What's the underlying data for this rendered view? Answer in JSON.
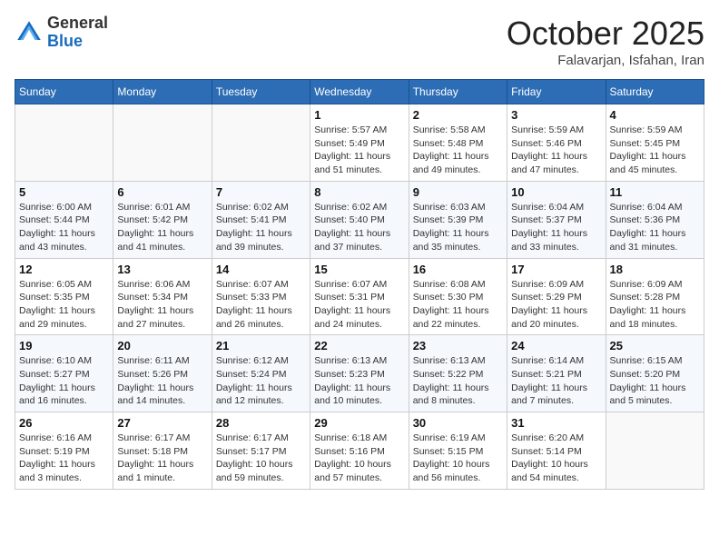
{
  "header": {
    "logo_general": "General",
    "logo_blue": "Blue",
    "month_title": "October 2025",
    "subtitle": "Falavarjan, Isfahan, Iran"
  },
  "weekdays": [
    "Sunday",
    "Monday",
    "Tuesday",
    "Wednesday",
    "Thursday",
    "Friday",
    "Saturday"
  ],
  "weeks": [
    [
      {
        "day": "",
        "sunrise": "",
        "sunset": "",
        "daylight": ""
      },
      {
        "day": "",
        "sunrise": "",
        "sunset": "",
        "daylight": ""
      },
      {
        "day": "",
        "sunrise": "",
        "sunset": "",
        "daylight": ""
      },
      {
        "day": "1",
        "sunrise": "Sunrise: 5:57 AM",
        "sunset": "Sunset: 5:49 PM",
        "daylight": "Daylight: 11 hours and 51 minutes."
      },
      {
        "day": "2",
        "sunrise": "Sunrise: 5:58 AM",
        "sunset": "Sunset: 5:48 PM",
        "daylight": "Daylight: 11 hours and 49 minutes."
      },
      {
        "day": "3",
        "sunrise": "Sunrise: 5:59 AM",
        "sunset": "Sunset: 5:46 PM",
        "daylight": "Daylight: 11 hours and 47 minutes."
      },
      {
        "day": "4",
        "sunrise": "Sunrise: 5:59 AM",
        "sunset": "Sunset: 5:45 PM",
        "daylight": "Daylight: 11 hours and 45 minutes."
      }
    ],
    [
      {
        "day": "5",
        "sunrise": "Sunrise: 6:00 AM",
        "sunset": "Sunset: 5:44 PM",
        "daylight": "Daylight: 11 hours and 43 minutes."
      },
      {
        "day": "6",
        "sunrise": "Sunrise: 6:01 AM",
        "sunset": "Sunset: 5:42 PM",
        "daylight": "Daylight: 11 hours and 41 minutes."
      },
      {
        "day": "7",
        "sunrise": "Sunrise: 6:02 AM",
        "sunset": "Sunset: 5:41 PM",
        "daylight": "Daylight: 11 hours and 39 minutes."
      },
      {
        "day": "8",
        "sunrise": "Sunrise: 6:02 AM",
        "sunset": "Sunset: 5:40 PM",
        "daylight": "Daylight: 11 hours and 37 minutes."
      },
      {
        "day": "9",
        "sunrise": "Sunrise: 6:03 AM",
        "sunset": "Sunset: 5:39 PM",
        "daylight": "Daylight: 11 hours and 35 minutes."
      },
      {
        "day": "10",
        "sunrise": "Sunrise: 6:04 AM",
        "sunset": "Sunset: 5:37 PM",
        "daylight": "Daylight: 11 hours and 33 minutes."
      },
      {
        "day": "11",
        "sunrise": "Sunrise: 6:04 AM",
        "sunset": "Sunset: 5:36 PM",
        "daylight": "Daylight: 11 hours and 31 minutes."
      }
    ],
    [
      {
        "day": "12",
        "sunrise": "Sunrise: 6:05 AM",
        "sunset": "Sunset: 5:35 PM",
        "daylight": "Daylight: 11 hours and 29 minutes."
      },
      {
        "day": "13",
        "sunrise": "Sunrise: 6:06 AM",
        "sunset": "Sunset: 5:34 PM",
        "daylight": "Daylight: 11 hours and 27 minutes."
      },
      {
        "day": "14",
        "sunrise": "Sunrise: 6:07 AM",
        "sunset": "Sunset: 5:33 PM",
        "daylight": "Daylight: 11 hours and 26 minutes."
      },
      {
        "day": "15",
        "sunrise": "Sunrise: 6:07 AM",
        "sunset": "Sunset: 5:31 PM",
        "daylight": "Daylight: 11 hours and 24 minutes."
      },
      {
        "day": "16",
        "sunrise": "Sunrise: 6:08 AM",
        "sunset": "Sunset: 5:30 PM",
        "daylight": "Daylight: 11 hours and 22 minutes."
      },
      {
        "day": "17",
        "sunrise": "Sunrise: 6:09 AM",
        "sunset": "Sunset: 5:29 PM",
        "daylight": "Daylight: 11 hours and 20 minutes."
      },
      {
        "day": "18",
        "sunrise": "Sunrise: 6:09 AM",
        "sunset": "Sunset: 5:28 PM",
        "daylight": "Daylight: 11 hours and 18 minutes."
      }
    ],
    [
      {
        "day": "19",
        "sunrise": "Sunrise: 6:10 AM",
        "sunset": "Sunset: 5:27 PM",
        "daylight": "Daylight: 11 hours and 16 minutes."
      },
      {
        "day": "20",
        "sunrise": "Sunrise: 6:11 AM",
        "sunset": "Sunset: 5:26 PM",
        "daylight": "Daylight: 11 hours and 14 minutes."
      },
      {
        "day": "21",
        "sunrise": "Sunrise: 6:12 AM",
        "sunset": "Sunset: 5:24 PM",
        "daylight": "Daylight: 11 hours and 12 minutes."
      },
      {
        "day": "22",
        "sunrise": "Sunrise: 6:13 AM",
        "sunset": "Sunset: 5:23 PM",
        "daylight": "Daylight: 11 hours and 10 minutes."
      },
      {
        "day": "23",
        "sunrise": "Sunrise: 6:13 AM",
        "sunset": "Sunset: 5:22 PM",
        "daylight": "Daylight: 11 hours and 8 minutes."
      },
      {
        "day": "24",
        "sunrise": "Sunrise: 6:14 AM",
        "sunset": "Sunset: 5:21 PM",
        "daylight": "Daylight: 11 hours and 7 minutes."
      },
      {
        "day": "25",
        "sunrise": "Sunrise: 6:15 AM",
        "sunset": "Sunset: 5:20 PM",
        "daylight": "Daylight: 11 hours and 5 minutes."
      }
    ],
    [
      {
        "day": "26",
        "sunrise": "Sunrise: 6:16 AM",
        "sunset": "Sunset: 5:19 PM",
        "daylight": "Daylight: 11 hours and 3 minutes."
      },
      {
        "day": "27",
        "sunrise": "Sunrise: 6:17 AM",
        "sunset": "Sunset: 5:18 PM",
        "daylight": "Daylight: 11 hours and 1 minute."
      },
      {
        "day": "28",
        "sunrise": "Sunrise: 6:17 AM",
        "sunset": "Sunset: 5:17 PM",
        "daylight": "Daylight: 10 hours and 59 minutes."
      },
      {
        "day": "29",
        "sunrise": "Sunrise: 6:18 AM",
        "sunset": "Sunset: 5:16 PM",
        "daylight": "Daylight: 10 hours and 57 minutes."
      },
      {
        "day": "30",
        "sunrise": "Sunrise: 6:19 AM",
        "sunset": "Sunset: 5:15 PM",
        "daylight": "Daylight: 10 hours and 56 minutes."
      },
      {
        "day": "31",
        "sunrise": "Sunrise: 6:20 AM",
        "sunset": "Sunset: 5:14 PM",
        "daylight": "Daylight: 10 hours and 54 minutes."
      },
      {
        "day": "",
        "sunrise": "",
        "sunset": "",
        "daylight": ""
      }
    ]
  ]
}
